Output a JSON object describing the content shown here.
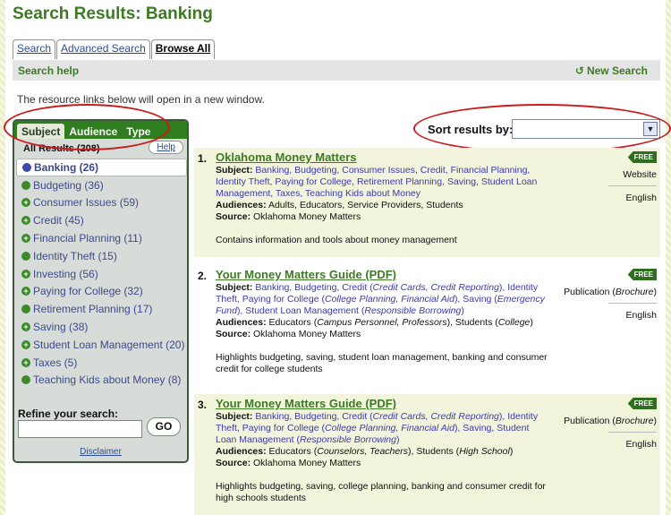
{
  "page": {
    "title": "Search Results: Banking"
  },
  "tabs": [
    {
      "label": "Search"
    },
    {
      "label": "Advanced Search"
    },
    {
      "label": "Browse All"
    }
  ],
  "subbar": {
    "search_help": "Search help",
    "new_search": "New Search",
    "new_search_icon": "refresh-icon"
  },
  "intro_text": "The resource links below will open in a new window.",
  "sort": {
    "label": "Sort results by:",
    "value": ""
  },
  "panel": {
    "tabs": [
      "Subject",
      "Audience",
      "Type"
    ],
    "all_results": "All Results (208)",
    "help": "Help",
    "categories": [
      {
        "label": "Banking (26)"
      },
      {
        "label": "Budgeting (36)"
      },
      {
        "label": "Consumer Issues (59)"
      },
      {
        "label": "Credit (45)"
      },
      {
        "label": "Financial Planning (11)"
      },
      {
        "label": "Identity Theft (15)"
      },
      {
        "label": "Investing (56)"
      },
      {
        "label": "Paying for College (32)"
      },
      {
        "label": "Retirement Planning (17)"
      },
      {
        "label": "Saving (38)"
      },
      {
        "label": "Student Loan Management (20)"
      },
      {
        "label": "Taxes (5)"
      },
      {
        "label": "Teaching Kids about Money (8)"
      }
    ],
    "refine_label": "Refine your search:",
    "refine_value": "",
    "go": "GO",
    "disclaimer": "Disclaimer"
  },
  "labels": {
    "subject": "Subject:",
    "audiences": "Audiences:",
    "source": "Source:"
  },
  "results": [
    {
      "num": "1.",
      "title": "Oklahoma Money Matters",
      "subject": "Banking, Budgeting, Consumer Issues, Credit, Financial Planning, Identity Theft, Paying for College, Retirement Planning, Saving, Student Loan Management, Taxes, Teaching Kids about Money",
      "audiences": "Adults, Educators, Service Providers, Students",
      "source": "Oklahoma Money Matters",
      "description": "Contains information and tools about money management",
      "badge": "FREE",
      "type": "Website",
      "type_detail": "",
      "language": "English"
    },
    {
      "num": "2.",
      "title": "Your Money Matters Guide (PDF)",
      "subject_parts": [
        "Banking, Budgeting, Credit (",
        "Credit Cards, Credit Reporting",
        "), Identity Theft, Paying for College (",
        "College Planning, Financial Aid",
        "), Saving (",
        "Emergency Fund",
        "), Student Loan Management (",
        "Responsible Borrowing",
        ")"
      ],
      "audience_parts": [
        "Educators (",
        "Campus Personnel, Professors",
        "), Students (",
        "College",
        ")"
      ],
      "source": "Oklahoma Money Matters",
      "description": "Highlights budgeting, saving, student loan management, banking and consumer credit for college students",
      "badge": "FREE",
      "type": "Publication (",
      "type_detail": "Brochure",
      "type_end": ")",
      "language": "English"
    },
    {
      "num": "3.",
      "title": "Your Money Matters Guide (PDF)",
      "subject_parts": [
        "Banking, Budgeting, Credit (",
        "Credit Cards, Credit Reporting",
        "), Identity Theft, Paying for College (",
        "College Planning, Financial Aid",
        "), Saving, Student Loan Management (",
        "Responsible Borrowing",
        ")"
      ],
      "audience_parts": [
        "Educators (",
        "Counselors, Teachers",
        "), Students (",
        "High School",
        ")"
      ],
      "source": "Oklahoma Money Matters",
      "description": "Highlights budgeting, saving, college planning, banking and consumer credit for high schools students",
      "badge": "FREE",
      "type": "Publication (",
      "type_detail": "Brochure",
      "type_end": ")",
      "language": "English"
    }
  ]
}
